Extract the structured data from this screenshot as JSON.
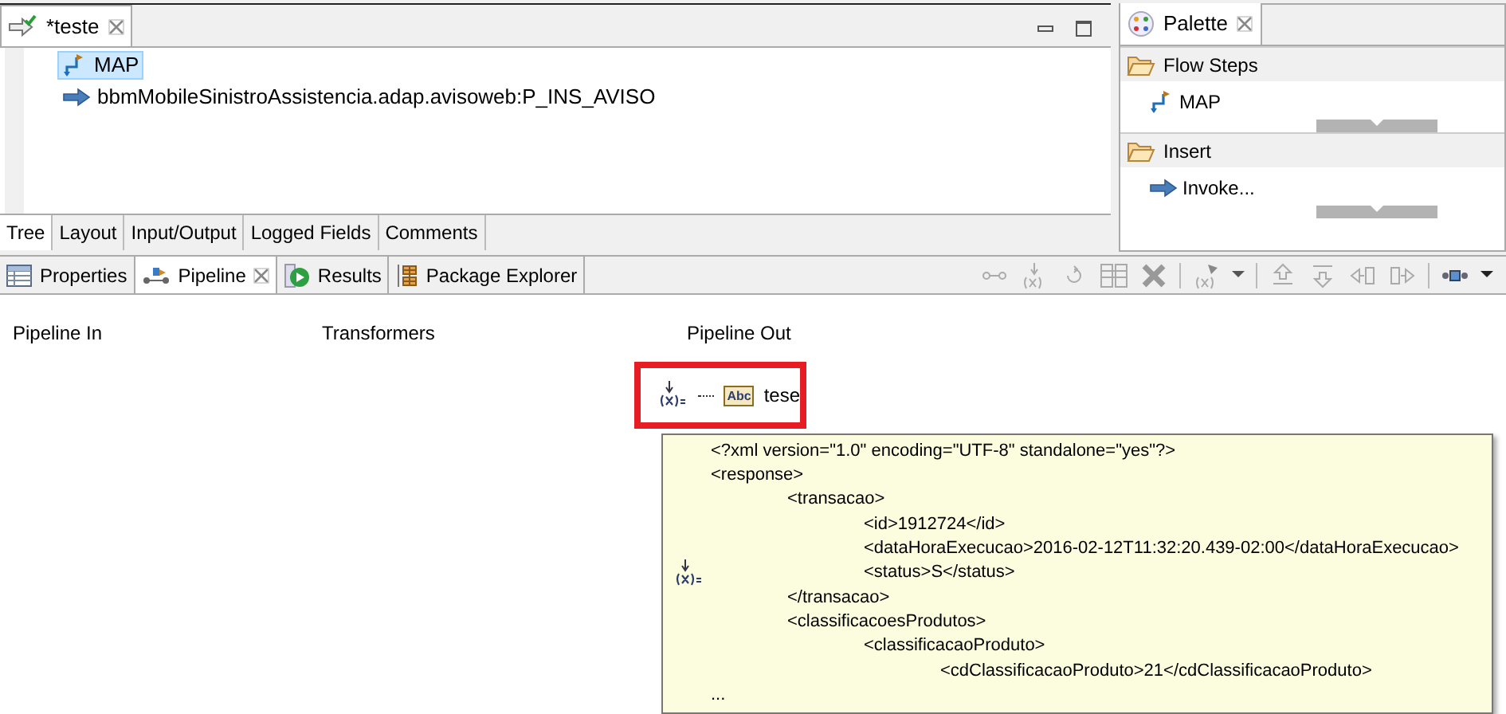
{
  "editor": {
    "tabs": [
      {
        "label": "*teste",
        "selected": true
      }
    ],
    "tree": [
      {
        "kind": "map",
        "label": "MAP",
        "selected": true
      },
      {
        "kind": "invoke",
        "label": "bbmMobileSinistroAssistencia.adap.avisoweb:P_INS_AVISO",
        "selected": false
      }
    ],
    "bottom_tabs": [
      {
        "label": "Tree",
        "selected": true
      },
      {
        "label": "Layout",
        "selected": false
      },
      {
        "label": "Input/Output",
        "selected": false
      },
      {
        "label": "Logged Fields",
        "selected": false
      },
      {
        "label": "Comments",
        "selected": false
      }
    ]
  },
  "palette": {
    "title": "Palette",
    "groups": [
      {
        "label": "Flow Steps",
        "items": [
          {
            "kind": "map",
            "label": "MAP"
          }
        ]
      },
      {
        "label": "Insert",
        "items": [
          {
            "kind": "invoke",
            "label": "Invoke..."
          }
        ]
      }
    ]
  },
  "views": {
    "tabs": [
      {
        "kind": "properties",
        "label": "Properties",
        "selected": false
      },
      {
        "kind": "pipeline",
        "label": "Pipeline",
        "selected": true
      },
      {
        "kind": "results",
        "label": "Results",
        "selected": false
      },
      {
        "kind": "explorer",
        "label": "Package Explorer",
        "selected": false
      }
    ]
  },
  "pipeline": {
    "columns": [
      "Pipeline In",
      "Transformers",
      "Pipeline Out"
    ],
    "out_variable": "tese",
    "out_type": "Abc",
    "tooltip": [
      {
        "text": "<?xml version=\"1.0\" encoding=\"UTF-8\" standalone=\"yes\"?>"
      },
      {
        "text": "<response>",
        "children": [
          {
            "text": "<transacao>",
            "children": [
              {
                "text": "<id>1912724</id>"
              },
              {
                "text": "<dataHoraExecucao>2016-02-12T11:32:20.439-02:00</dataHoraExecucao>"
              },
              {
                "text": "<status>S</status>"
              }
            ]
          },
          {
            "text": "</transacao>"
          },
          {
            "text": "<classificacoesProdutos>",
            "children": [
              {
                "text": "<classificacaoProduto>",
                "children": [
                  {
                    "text": "<cdClassificacaoProduto>21</cdClassificacaoProduto>"
                  }
                ]
              }
            ]
          }
        ]
      },
      {
        "text": "..."
      }
    ]
  }
}
